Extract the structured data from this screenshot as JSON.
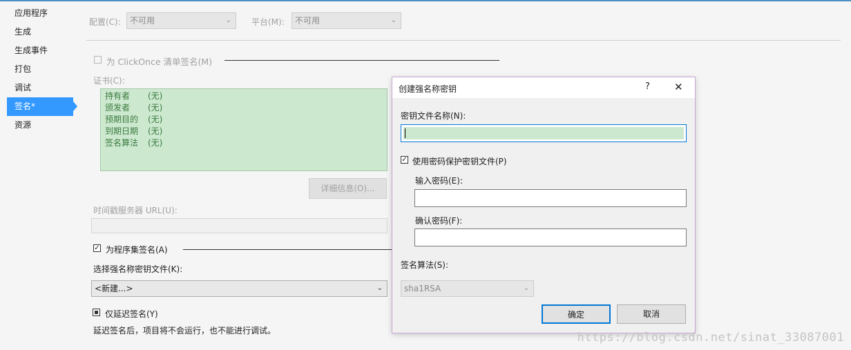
{
  "sidebar": {
    "items": [
      {
        "label": "应用程序"
      },
      {
        "label": "生成"
      },
      {
        "label": "生成事件"
      },
      {
        "label": "打包"
      },
      {
        "label": "调试"
      },
      {
        "label": "签名*",
        "active": true
      },
      {
        "label": "资源"
      }
    ]
  },
  "config": {
    "label": "配置(C):",
    "value": "不可用"
  },
  "platform": {
    "label": "平台(M):",
    "value": "不可用"
  },
  "clickonce": {
    "label": "为 ClickOnce 清单签名(M)",
    "checked": false,
    "enabled": false
  },
  "certificate": {
    "label": "证书(C):",
    "rows": [
      {
        "key": "持有者",
        "value": "(无)"
      },
      {
        "key": "颁发者",
        "value": "(无)"
      },
      {
        "key": "预期目的",
        "value": "(无)"
      },
      {
        "key": "到期日期",
        "value": "(无)"
      },
      {
        "key": "签名算法",
        "value": "(无)"
      }
    ],
    "details_button": "详细信息(O)..."
  },
  "timestamp": {
    "label": "时间戳服务器 URL(U):",
    "value": ""
  },
  "assembly_sign": {
    "label": "为程序集签名(A)",
    "checked": true
  },
  "key_file": {
    "label": "选择强名称密钥文件(K):",
    "value": "<新建...>"
  },
  "delay_sign": {
    "label": "仅延迟签名(Y)",
    "state": "indeterminate",
    "note": "延迟签名后，项目将不会运行，也不能进行调试。"
  },
  "dialog": {
    "title": "创建强名称密钥",
    "help": "?",
    "close": "✕",
    "key_name_label": "密钥文件名称(N):",
    "key_name_value": "",
    "use_password_label": "使用密码保护密钥文件(P)",
    "use_password_checked": true,
    "password_label": "输入密码(E):",
    "confirm_label": "确认密码(F):",
    "algorithm_label": "签名算法(S):",
    "algorithm_value": "sha1RSA",
    "ok": "确定",
    "cancel": "取消"
  },
  "watermark": "https://blog.csdn.net/sinat_33087001",
  "colors": {
    "accent": "#3399ff",
    "cert_bg": "#cce8cf",
    "dialog_border": "#c7a6d1"
  }
}
